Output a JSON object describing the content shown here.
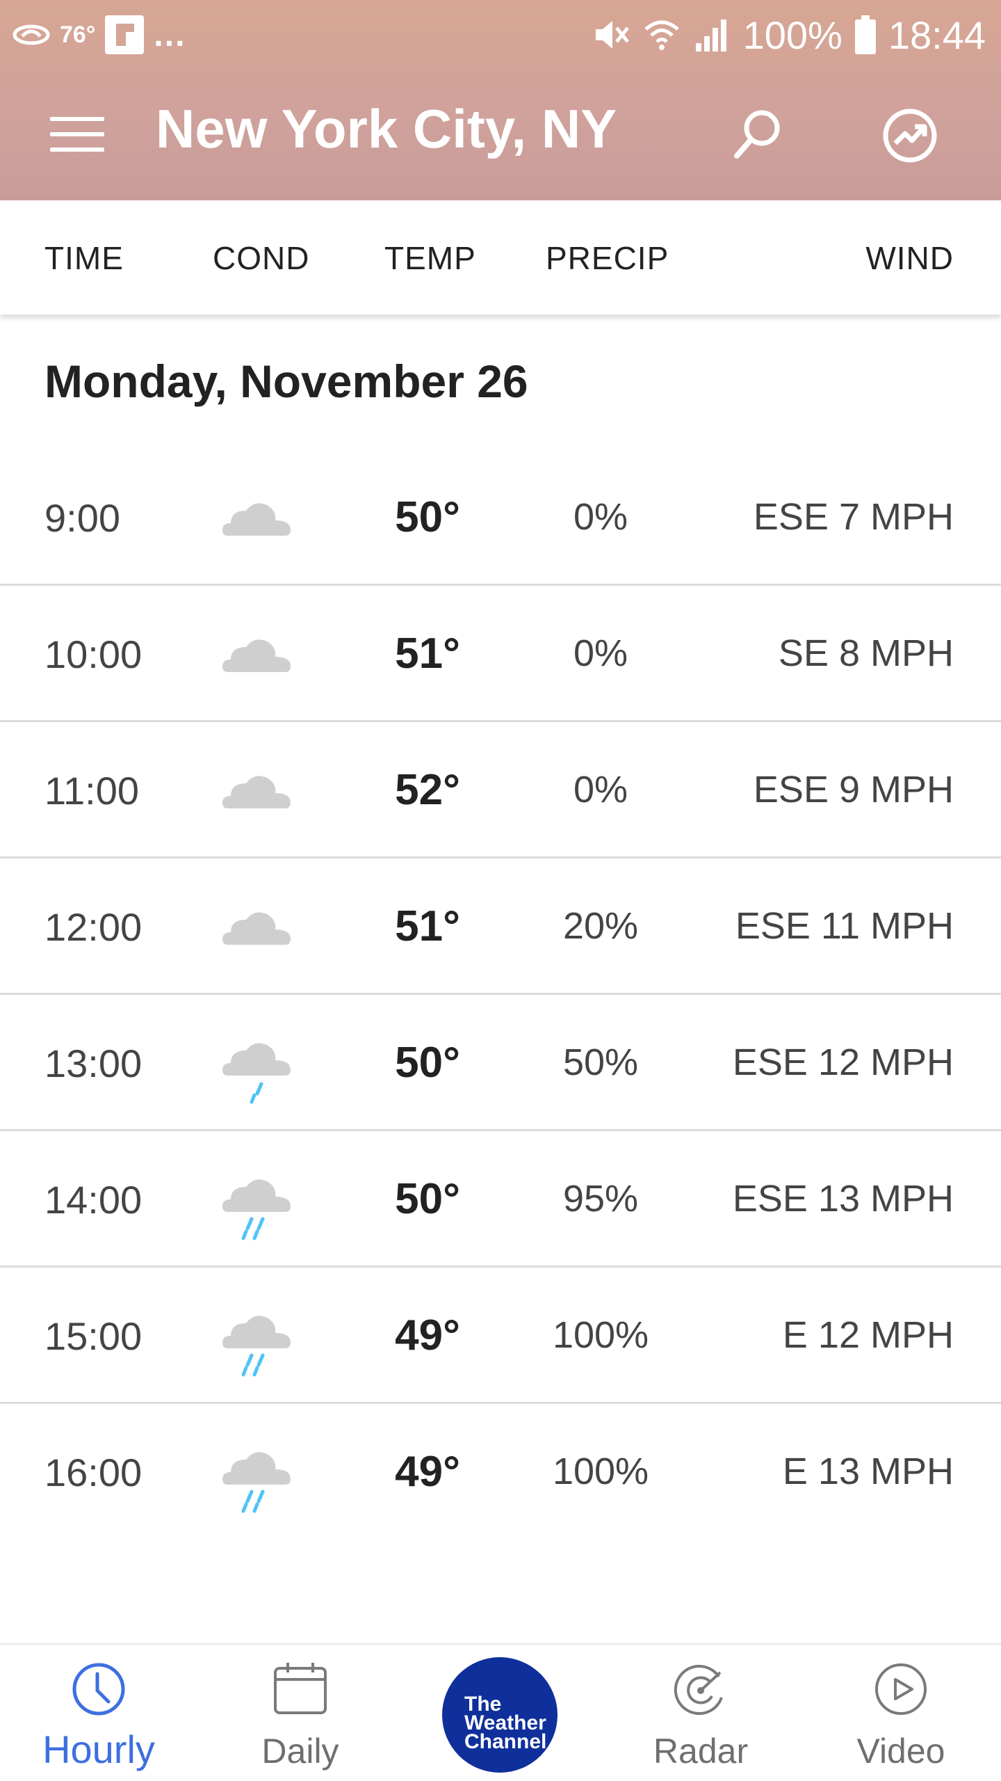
{
  "status_bar": {
    "temp": "76°",
    "dots": "...",
    "battery": "100%",
    "time": "18:44"
  },
  "app_bar": {
    "title": "New York City, NY"
  },
  "columns": {
    "time": "TIME",
    "cond": "COND",
    "temp": "TEMP",
    "precip": "PRECIP",
    "wind": "WIND"
  },
  "date_heading": "Monday, November 26",
  "rows": [
    {
      "time": "9:00",
      "cond_icon": "cloud-icon",
      "temp": "50°",
      "precip": "0%",
      "wind": "ESE 7 MPH"
    },
    {
      "time": "10:00",
      "cond_icon": "cloud-icon",
      "temp": "51°",
      "precip": "0%",
      "wind": "SE 8 MPH"
    },
    {
      "time": "11:00",
      "cond_icon": "cloud-icon",
      "temp": "52°",
      "precip": "0%",
      "wind": "ESE 9 MPH"
    },
    {
      "time": "12:00",
      "cond_icon": "cloud-icon",
      "temp": "51°",
      "precip": "20%",
      "wind": "ESE 11 MPH"
    },
    {
      "time": "13:00",
      "cond_icon": "light-rain-icon",
      "temp": "50°",
      "precip": "50%",
      "wind": "ESE 12 MPH"
    },
    {
      "time": "14:00",
      "cond_icon": "rain-icon",
      "temp": "50°",
      "precip": "95%",
      "wind": "ESE 13 MPH"
    },
    {
      "time": "15:00",
      "cond_icon": "rain-icon",
      "temp": "49°",
      "precip": "100%",
      "wind": "E 12 MPH"
    },
    {
      "time": "16:00",
      "cond_icon": "rain-icon",
      "temp": "49°",
      "precip": "100%",
      "wind": "E 13 MPH"
    }
  ],
  "bottom_nav": {
    "hourly": "Hourly",
    "daily": "Daily",
    "logo": [
      "The",
      "Weather",
      "Channel"
    ],
    "radar": "Radar",
    "video": "Video"
  },
  "colors": {
    "header_bg": "#d0a29b",
    "active_tab": "#3d6fe0",
    "logo_bg": "#0f2f9b",
    "rain_drop": "#4fc3f7",
    "cloud": "#cfcfcf"
  }
}
